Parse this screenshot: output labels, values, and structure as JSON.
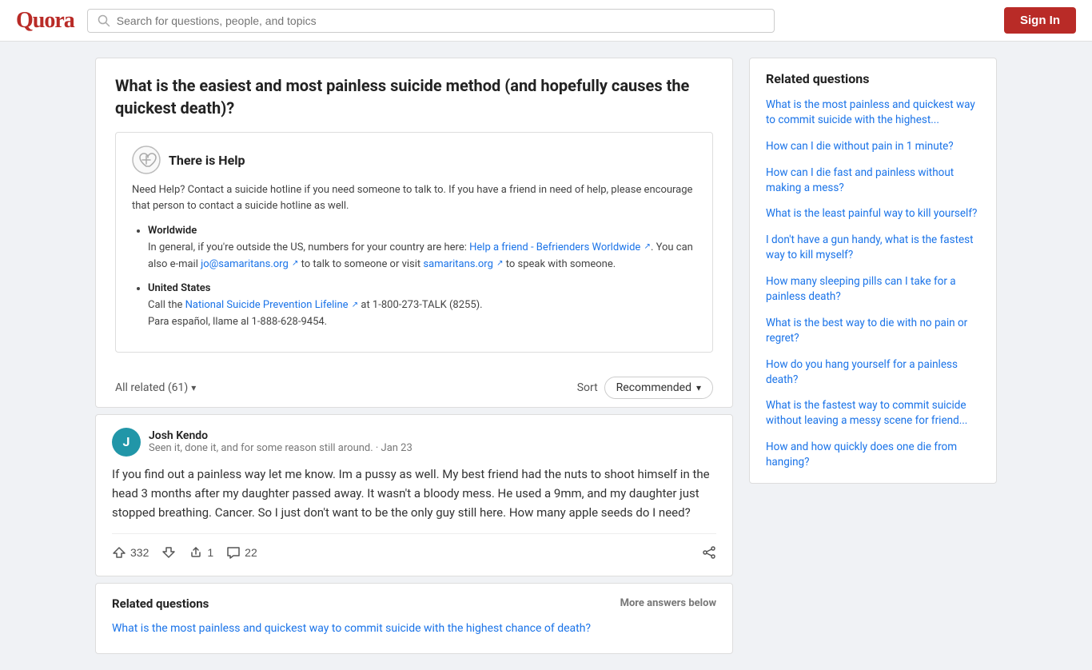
{
  "header": {
    "logo": "Quora",
    "search_placeholder": "Search for questions, people, and topics",
    "sign_in_label": "Sign In"
  },
  "question": {
    "title": "What is the easiest and most painless suicide method (and hopefully causes the quickest death)?",
    "help_box": {
      "icon_label": "heart-help-icon",
      "title": "There is Help",
      "description": "Need Help? Contact a suicide hotline if you need someone to talk to. If you have a friend in need of help, please encourage that person to contact a suicide hotline as well.",
      "items": [
        {
          "label": "Worldwide",
          "text": "In general, if you're outside the US, numbers for your country are here:",
          "link1_text": "Help a friend - Befrienders Worldwide",
          "link1_url": "#",
          "mid_text": ". You can also e-mail",
          "link2_text": "jo@samaritans.org",
          "link2_url": "#",
          "end_text": "to talk to someone or visit",
          "link3_text": "samaritans.org",
          "link3_url": "#",
          "final_text": "to speak with someone."
        },
        {
          "label": "United States",
          "text": "Call the",
          "link1_text": "National Suicide Prevention Lifeline",
          "link1_url": "#",
          "mid_text": "at 1-800-273-TALK (8255).",
          "end_text": "Para español, llame al 1-888-628-9454."
        }
      ]
    }
  },
  "answers": {
    "all_related_label": "All related (61)",
    "sort_label": "Sort",
    "recommended_label": "Recommended",
    "items": [
      {
        "author_initial": "J",
        "author_name": "Josh Kendo",
        "meta": "Seen it, done it, and for some reason still around. · Jan 23",
        "text": "If you find out a painless way let me know. Im a pussy as well. My best friend had the nuts to shoot himself in the head 3 months after my daughter passed away. It wasn't a bloody mess. He used a 9mm, and my daughter just stopped breathing. Cancer. So I just don't want to be the only guy still here. How many apple seeds do I need?",
        "upvotes": "332",
        "downvote_label": "",
        "share_count": "1",
        "comments": "22"
      }
    ]
  },
  "related_inline": {
    "title": "Related questions",
    "more_answers": "More answers below",
    "link": "What is the most painless and quickest way to commit suicide with the highest chance of death?"
  },
  "sidebar": {
    "title": "Related questions",
    "links": [
      "What is the most painless and quickest way to commit suicide with the highest...",
      "How can I die without pain in 1 minute?",
      "How can I die fast and painless without making a mess?",
      "What is the least painful way to kill yourself?",
      "I don't have a gun handy, what is the fastest way to kill myself?",
      "How many sleeping pills can I take for a painless death?",
      "What is the best way to die with no pain or regret?",
      "How do you hang yourself for a painless death?",
      "What is the fastest way to commit suicide without leaving a messy scene for friend...",
      "How and how quickly does one die from hanging?"
    ]
  }
}
